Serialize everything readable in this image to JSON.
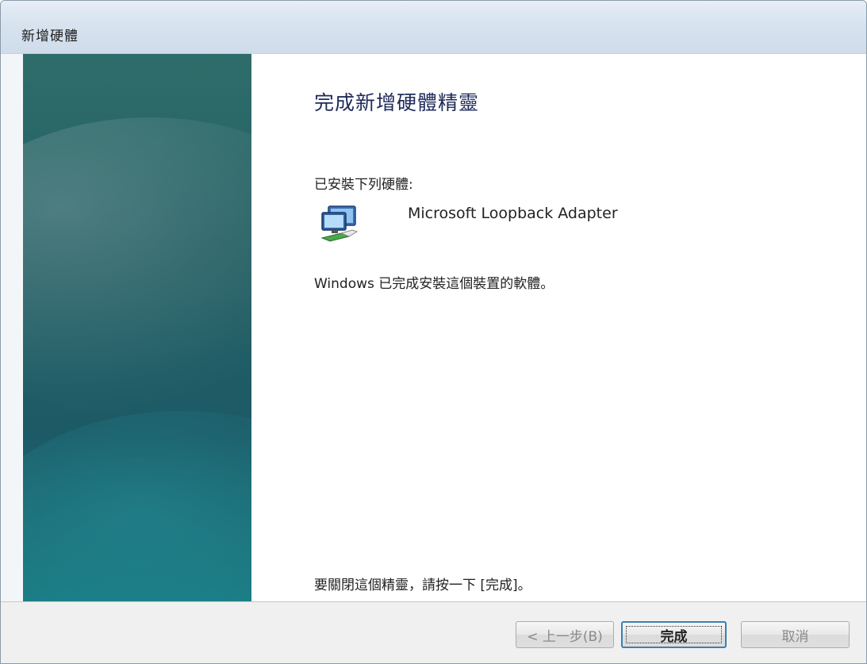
{
  "window": {
    "title": "新增硬體"
  },
  "content": {
    "heading": "完成新增硬體精靈",
    "installed_label": "已安裝下列硬體:",
    "device_name": "Microsoft Loopback Adapter",
    "device_icon": "network-adapter-icon",
    "windows_message": "Windows 已完成安裝這個裝置的軟體。",
    "close_hint": "要關閉這個精靈，請按一下 [完成]。"
  },
  "buttons": {
    "back_label": "< 上一步(B)",
    "finish_label": "完成",
    "cancel_label": "取消"
  },
  "colors": {
    "side_panel": "#245f63",
    "heading": "#1e2a5a",
    "finish_border": "#3c7fb1"
  }
}
